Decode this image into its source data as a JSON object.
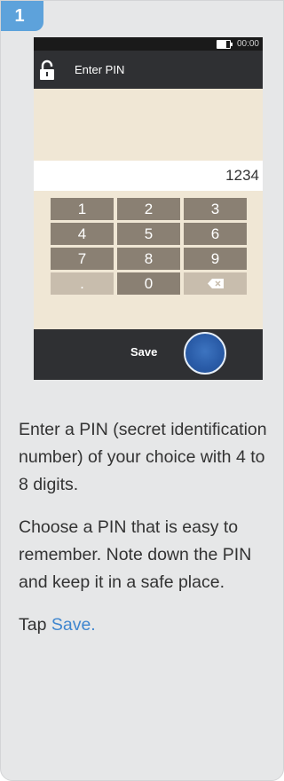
{
  "step": {
    "number": "1"
  },
  "device": {
    "status_time": "00:00",
    "title": "Enter PIN",
    "pin_value": "1234",
    "keypad": [
      "1",
      "2",
      "3",
      "4",
      "5",
      "6",
      "7",
      "8",
      "9",
      ".",
      "0",
      "delete"
    ],
    "save_label": "Save"
  },
  "instructions": {
    "paragraph1": "Enter a PIN (secret identification number) of your choice with 4 to 8 digits.",
    "paragraph2": "Choose a PIN that is easy to remember. Note down the PIN and keep it in a safe place.",
    "paragraph3_prefix": "Tap ",
    "paragraph3_link": "Save."
  },
  "colors": {
    "accent": "#3f86cf",
    "badge": "#5da2db",
    "key_dark": "#8a8073",
    "key_light": "#c8bdad",
    "screen_bg": "#f0e7d5",
    "bar": "#2f3033"
  }
}
